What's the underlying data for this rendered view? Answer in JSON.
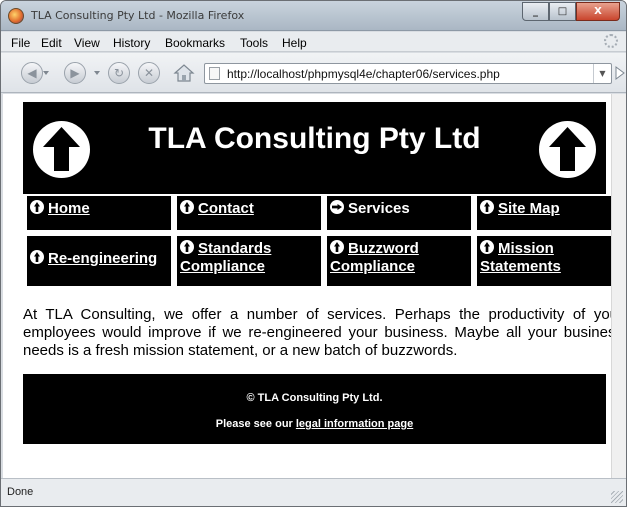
{
  "window": {
    "title": "TLA Consulting Pty Ltd - Mozilla Firefox",
    "buttons": {
      "minimize": "_",
      "maximize": "□",
      "close": "X"
    }
  },
  "menubar": {
    "items": [
      "File",
      "Edit",
      "View",
      "History",
      "Bookmarks",
      "Tools",
      "Help"
    ]
  },
  "navbar": {
    "url": "http://localhost/phpmysql4e/chapter06/services.php",
    "icons": [
      "back-icon",
      "forward-icon",
      "reload-icon",
      "stop-icon",
      "home-icon"
    ]
  },
  "page": {
    "heading": "TLA Consulting Pty Ltd",
    "menu": [
      {
        "label": "Home",
        "link": true,
        "icon": "up"
      },
      {
        "label": "Contact",
        "link": true,
        "icon": "up"
      },
      {
        "label": "Services",
        "link": false,
        "icon": "right"
      },
      {
        "label": "Site Map",
        "link": true,
        "icon": "up"
      },
      {
        "label": "Re-engineering",
        "link": true,
        "icon": "up"
      },
      {
        "label": "Standards Compliance",
        "link": true,
        "icon": "up"
      },
      {
        "label": "Buzzword Compliance",
        "link": true,
        "icon": "up"
      },
      {
        "label": "Mission Statements",
        "link": true,
        "icon": "up"
      }
    ],
    "body": "At TLA Consulting, we offer a number of services. Perhaps the productivity of your employees would improve if we re-engineered your business. Maybe all your business needs is a fresh mission statement, or a new batch of buzzwords.",
    "footer": {
      "copyright": "© TLA Consulting Pty Ltd.",
      "legal_prefix": "Please see our ",
      "legal_link": "legal information page"
    }
  },
  "statusbar": {
    "text": "Done"
  }
}
